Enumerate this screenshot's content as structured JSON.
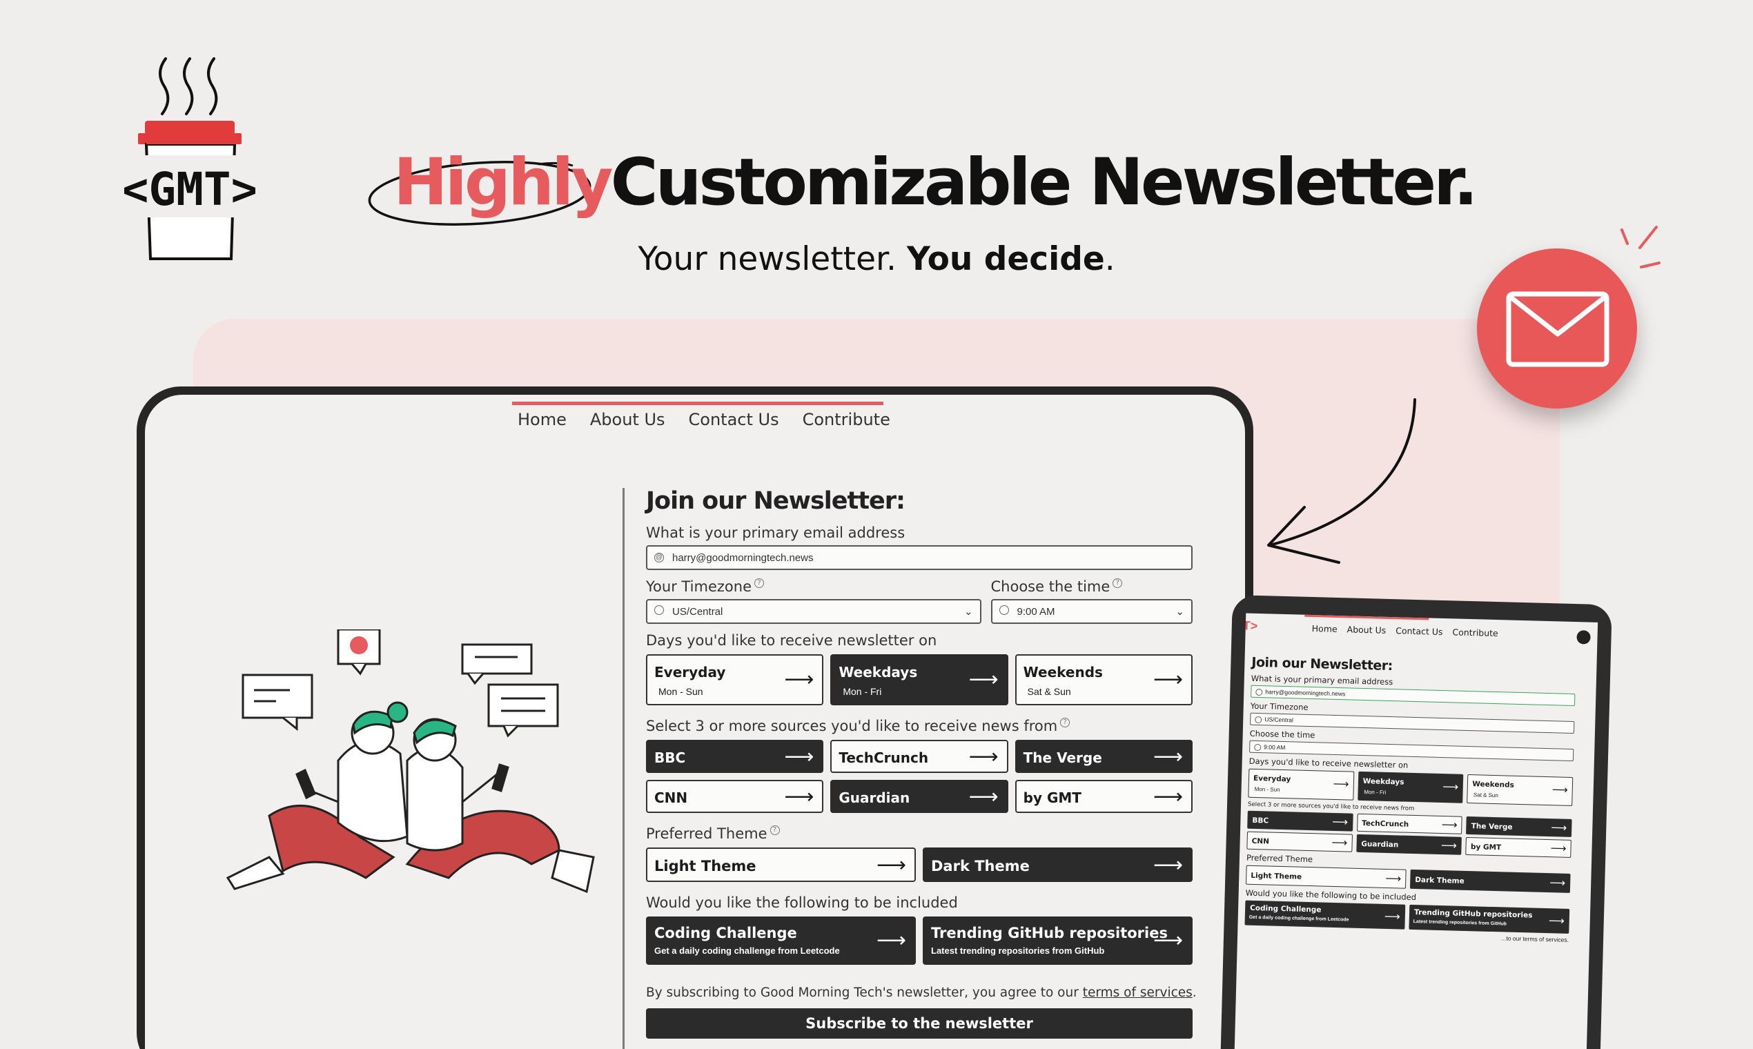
{
  "brand": {
    "logo_text": "<GMT>"
  },
  "hero": {
    "title_highlight": "Highly",
    "title_rest": "Customizable Newsletter.",
    "subtitle_plain": "Your newsletter. ",
    "subtitle_bold": "You decide",
    "subtitle_end": "."
  },
  "colors": {
    "accent": "#e65b5e",
    "dark": "#2b2b2b",
    "background": "#efeeec",
    "panel": "#f5e3e2"
  },
  "nav": {
    "home": "Home",
    "about": "About Us",
    "contact": "Contact Us",
    "contribute": "Contribute"
  },
  "form": {
    "title": "Join our Newsletter:",
    "email_label": "What is your primary email address",
    "email_value": "harry@goodmorningtech.news",
    "timezone_label": "Your Timezone",
    "timezone_value": "US/Central",
    "time_label": "Choose the time",
    "time_value": "9:00 AM",
    "days_label": "Days you'd like to receive newsletter on",
    "days": [
      {
        "title": "Everyday",
        "sub": "Mon - Sun",
        "selected": false
      },
      {
        "title": "Weekdays",
        "sub": "Mon - Fri",
        "selected": true
      },
      {
        "title": "Weekends",
        "sub": "Sat & Sun",
        "selected": false
      }
    ],
    "sources_label": "Select 3 or more sources you'd like to receive news from",
    "sources": [
      {
        "name": "BBC",
        "selected": true
      },
      {
        "name": "TechCrunch",
        "selected": false
      },
      {
        "name": "The Verge",
        "selected": true
      },
      {
        "name": "CNN",
        "selected": false
      },
      {
        "name": "Guardian",
        "selected": true
      },
      {
        "name": "by GMT",
        "selected": false
      }
    ],
    "theme_label": "Preferred Theme",
    "themes": [
      {
        "name": "Light Theme",
        "selected": false
      },
      {
        "name": "Dark Theme",
        "selected": true
      }
    ],
    "include_label": "Would you like the following to be included",
    "includes": [
      {
        "title": "Coding Challenge",
        "sub": "Get a daily coding challenge from Leetcode",
        "selected": true
      },
      {
        "title": "Trending GitHub repositories",
        "sub": "Latest trending repositories from GitHub",
        "selected": true
      }
    ],
    "terms_prefix": "By subscribing to Good Morning Tech's newsletter, you agree to our ",
    "terms_link": "terms of services",
    "terms_suffix": ".",
    "subscribe_label": "Subscribe to the newsletter"
  },
  "tablet": {
    "logo_fragment": "T>",
    "email_value": "harry@goodmorningtech.news",
    "sources_label": "Select 3 or more sources you'd like to receive news from",
    "terms_fragment": "...to our terms of services."
  },
  "icons": [
    "steam-icon",
    "coffee-cup-icon",
    "envelope-icon",
    "curved-arrow-icon",
    "sparkle-icon",
    "globe-icon",
    "clock-icon",
    "at-icon",
    "arrow-right-icon",
    "help-icon",
    "chat-bubble-icon"
  ]
}
